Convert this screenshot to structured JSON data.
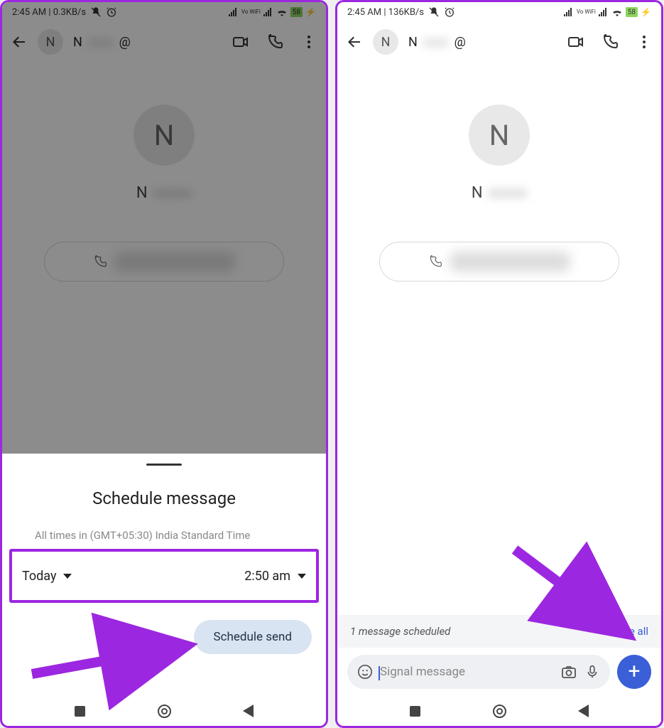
{
  "left": {
    "status": {
      "left": "2:45 AM | 0.3KB/s",
      "vowifi": "Vo\nWiFi",
      "battery": "58"
    },
    "header": {
      "avatar_letter": "N",
      "name_prefix": "N",
      "at": "@"
    },
    "contact": {
      "avatar_letter": "N",
      "name_prefix": "N"
    },
    "sheet": {
      "title": "Schedule message",
      "tz": "All times in (GMT+05:30) India Standard Time",
      "date": "Today",
      "time": "2:50 am",
      "button": "Schedule send"
    }
  },
  "right": {
    "status": {
      "left": "2:45 AM | 136KB/s",
      "vowifi": "Vo\nWiFi",
      "battery": "58"
    },
    "header": {
      "avatar_letter": "N",
      "name_prefix": "N",
      "at": "@"
    },
    "contact": {
      "avatar_letter": "N",
      "name_prefix": "N"
    },
    "banner": {
      "text": "1 message scheduled",
      "see_all": "See all"
    },
    "input": {
      "placeholder": "Signal message"
    }
  }
}
